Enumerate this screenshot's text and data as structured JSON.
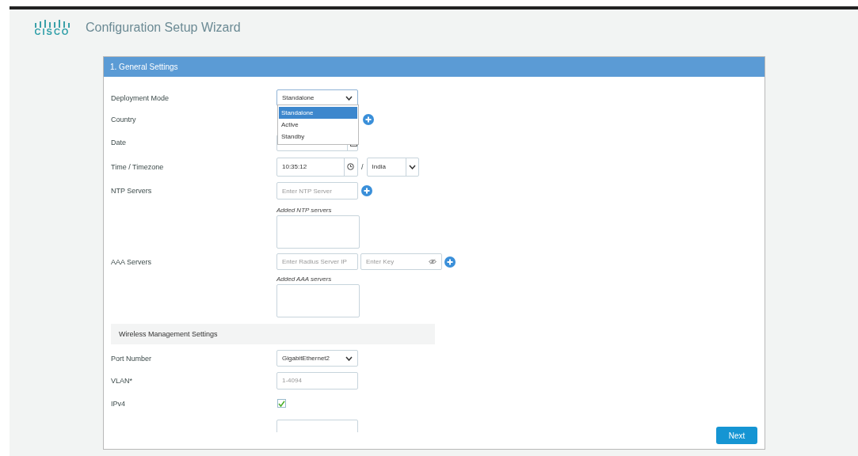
{
  "header": {
    "logo_text": "CISCO",
    "title": "Configuration Setup Wizard"
  },
  "panel": {
    "title": "1. General Settings"
  },
  "rows": [
    {
      "kind": "select",
      "label": "Deployment Mode",
      "value": "Standalone",
      "open": true,
      "options": [
        {
          "label": "Standalone",
          "selected": true
        },
        {
          "label": "Active",
          "selected": false
        },
        {
          "label": "Standby",
          "selected": false
        }
      ]
    },
    {
      "kind": "covered_add",
      "label": "Country"
    },
    {
      "kind": "date",
      "label": "Date"
    },
    {
      "kind": "time",
      "label": "Time / Timezone",
      "value": "10:35:12",
      "separator": "/",
      "timezone": "India"
    },
    {
      "kind": "add_input",
      "label": "NTP Servers",
      "placeholder": "Enter NTP Server"
    },
    {
      "kind": "list",
      "caption": "Added NTP servers"
    },
    {
      "kind": "add_pair",
      "label": "AAA Servers",
      "placeholder": "Enter Radius Server IP",
      "key_placeholder": "Enter Key"
    },
    {
      "kind": "list",
      "caption": "Added AAA servers"
    },
    {
      "kind": "section",
      "label": "Wireless Management Settings"
    },
    {
      "kind": "select",
      "label": "Port Number",
      "value": "GigabitEthernet2",
      "open": false
    },
    {
      "kind": "input",
      "label": "VLAN*",
      "placeholder": "1-4094"
    },
    {
      "kind": "checkbox",
      "label": "IPv4",
      "checked": true
    },
    {
      "kind": "cut"
    }
  ],
  "buttons": {
    "next": "Next"
  }
}
